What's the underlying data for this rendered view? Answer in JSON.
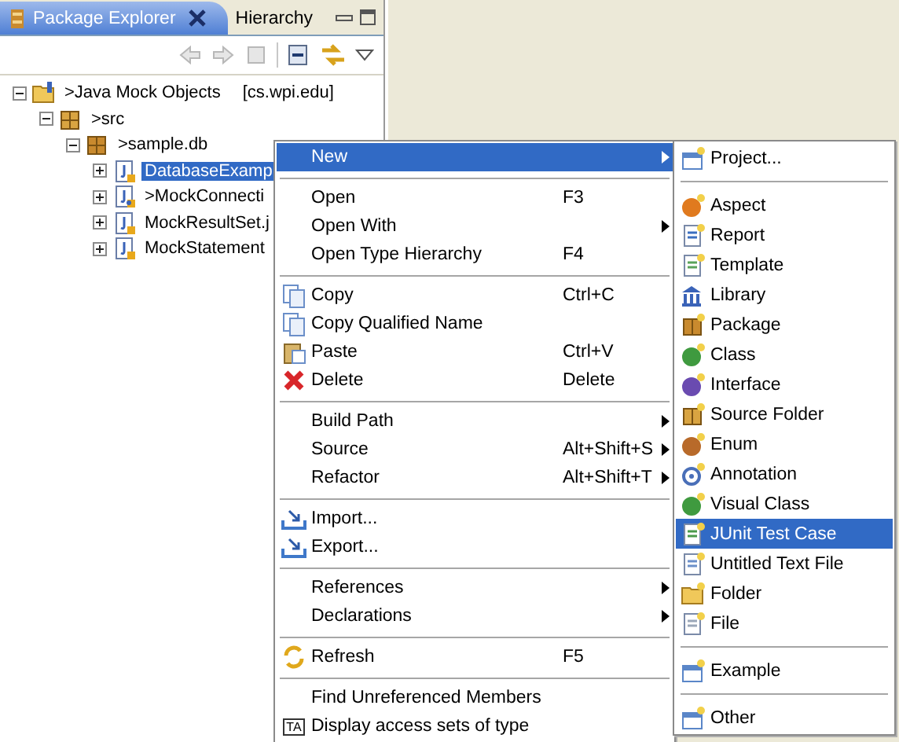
{
  "tabs": [
    {
      "label": "Package Explorer",
      "selected": true,
      "closable": true
    },
    {
      "label": "Hierarchy",
      "selected": false,
      "closable": false
    }
  ],
  "tree": [
    {
      "label": ">Java Mock Objects",
      "decoration": "[cs.wpi.edu]",
      "kind": "project",
      "expanded": true,
      "selected": false,
      "children": [
        {
          "label": ">src",
          "kind": "source-folder",
          "expanded": true,
          "selected": false,
          "children": [
            {
              "label": ">sample.db",
              "kind": "package",
              "expanded": true,
              "selected": false,
              "children": [
                {
                  "label": "DatabaseExamp",
                  "kind": "java-file",
                  "expanded": false,
                  "selected": true
                },
                {
                  "label": ">MockConnecti",
                  "kind": "java-file-changed",
                  "expanded": false,
                  "selected": false
                },
                {
                  "label": "MockResultSet.j",
                  "kind": "java-file",
                  "expanded": false,
                  "selected": false
                },
                {
                  "label": "MockStatement",
                  "kind": "java-file",
                  "expanded": false,
                  "selected": false
                }
              ]
            }
          ]
        }
      ]
    }
  ],
  "context_menu": {
    "items": [
      {
        "kind": "item",
        "label": "New",
        "submenu": true,
        "selected": true
      },
      {
        "kind": "separator"
      },
      {
        "kind": "item",
        "label": "Open",
        "shortcut": "F3",
        "submenu": false,
        "selected": false
      },
      {
        "kind": "item",
        "label": "Open With",
        "submenu": true,
        "selected": false
      },
      {
        "kind": "item",
        "label": "Open Type Hierarchy",
        "shortcut": "F4",
        "submenu": false,
        "selected": false
      },
      {
        "kind": "separator"
      },
      {
        "kind": "item",
        "label": "Copy",
        "shortcut": "Ctrl+C",
        "submenu": false,
        "selected": false
      },
      {
        "kind": "item",
        "label": "Copy Qualified Name",
        "submenu": false,
        "selected": false
      },
      {
        "kind": "item",
        "label": "Paste",
        "shortcut": "Ctrl+V",
        "submenu": false,
        "selected": false
      },
      {
        "kind": "item",
        "label": "Delete",
        "shortcut": "Delete",
        "submenu": false,
        "selected": false
      },
      {
        "kind": "separator"
      },
      {
        "kind": "item",
        "label": "Build Path",
        "submenu": true,
        "selected": false
      },
      {
        "kind": "item",
        "label": "Source",
        "shortcut": "Alt+Shift+S",
        "submenu": true,
        "selected": false
      },
      {
        "kind": "item",
        "label": "Refactor",
        "shortcut": "Alt+Shift+T",
        "submenu": true,
        "selected": false
      },
      {
        "kind": "separator"
      },
      {
        "kind": "item",
        "label": "Import...",
        "submenu": false,
        "selected": false
      },
      {
        "kind": "item",
        "label": "Export...",
        "submenu": false,
        "selected": false
      },
      {
        "kind": "separator"
      },
      {
        "kind": "item",
        "label": "References",
        "submenu": true,
        "selected": false
      },
      {
        "kind": "item",
        "label": "Declarations",
        "submenu": true,
        "selected": false
      },
      {
        "kind": "separator"
      },
      {
        "kind": "item",
        "label": "Refresh",
        "shortcut": "F5",
        "submenu": false,
        "selected": false
      },
      {
        "kind": "separator"
      },
      {
        "kind": "item",
        "label": "Find Unreferenced Members",
        "submenu": false,
        "selected": false
      },
      {
        "kind": "item",
        "label": "Display access sets of type",
        "icon_text": "TA",
        "submenu": false,
        "selected": false
      }
    ]
  },
  "new_submenu": {
    "items": [
      {
        "kind": "item",
        "label": "Project...",
        "selected": false
      },
      {
        "kind": "separator"
      },
      {
        "kind": "item",
        "label": "Aspect",
        "selected": false
      },
      {
        "kind": "item",
        "label": "Report",
        "selected": false
      },
      {
        "kind": "item",
        "label": "Template",
        "selected": false
      },
      {
        "kind": "item",
        "label": "Library",
        "selected": false
      },
      {
        "kind": "item",
        "label": "Package",
        "selected": false
      },
      {
        "kind": "item",
        "label": "Class",
        "selected": false
      },
      {
        "kind": "item",
        "label": "Interface",
        "selected": false
      },
      {
        "kind": "item",
        "label": "Source Folder",
        "selected": false
      },
      {
        "kind": "item",
        "label": "Enum",
        "selected": false
      },
      {
        "kind": "item",
        "label": "Annotation",
        "selected": false
      },
      {
        "kind": "item",
        "label": "Visual Class",
        "selected": false
      },
      {
        "kind": "item",
        "label": "JUnit Test Case",
        "selected": true
      },
      {
        "kind": "item",
        "label": "Untitled Text File",
        "selected": false
      },
      {
        "kind": "item",
        "label": "Folder",
        "selected": false
      },
      {
        "kind": "item",
        "label": "File",
        "selected": false
      },
      {
        "kind": "separator"
      },
      {
        "kind": "item",
        "label": "Example",
        "selected": false
      },
      {
        "kind": "separator"
      },
      {
        "kind": "item",
        "label": "Other",
        "selected": false
      }
    ]
  }
}
